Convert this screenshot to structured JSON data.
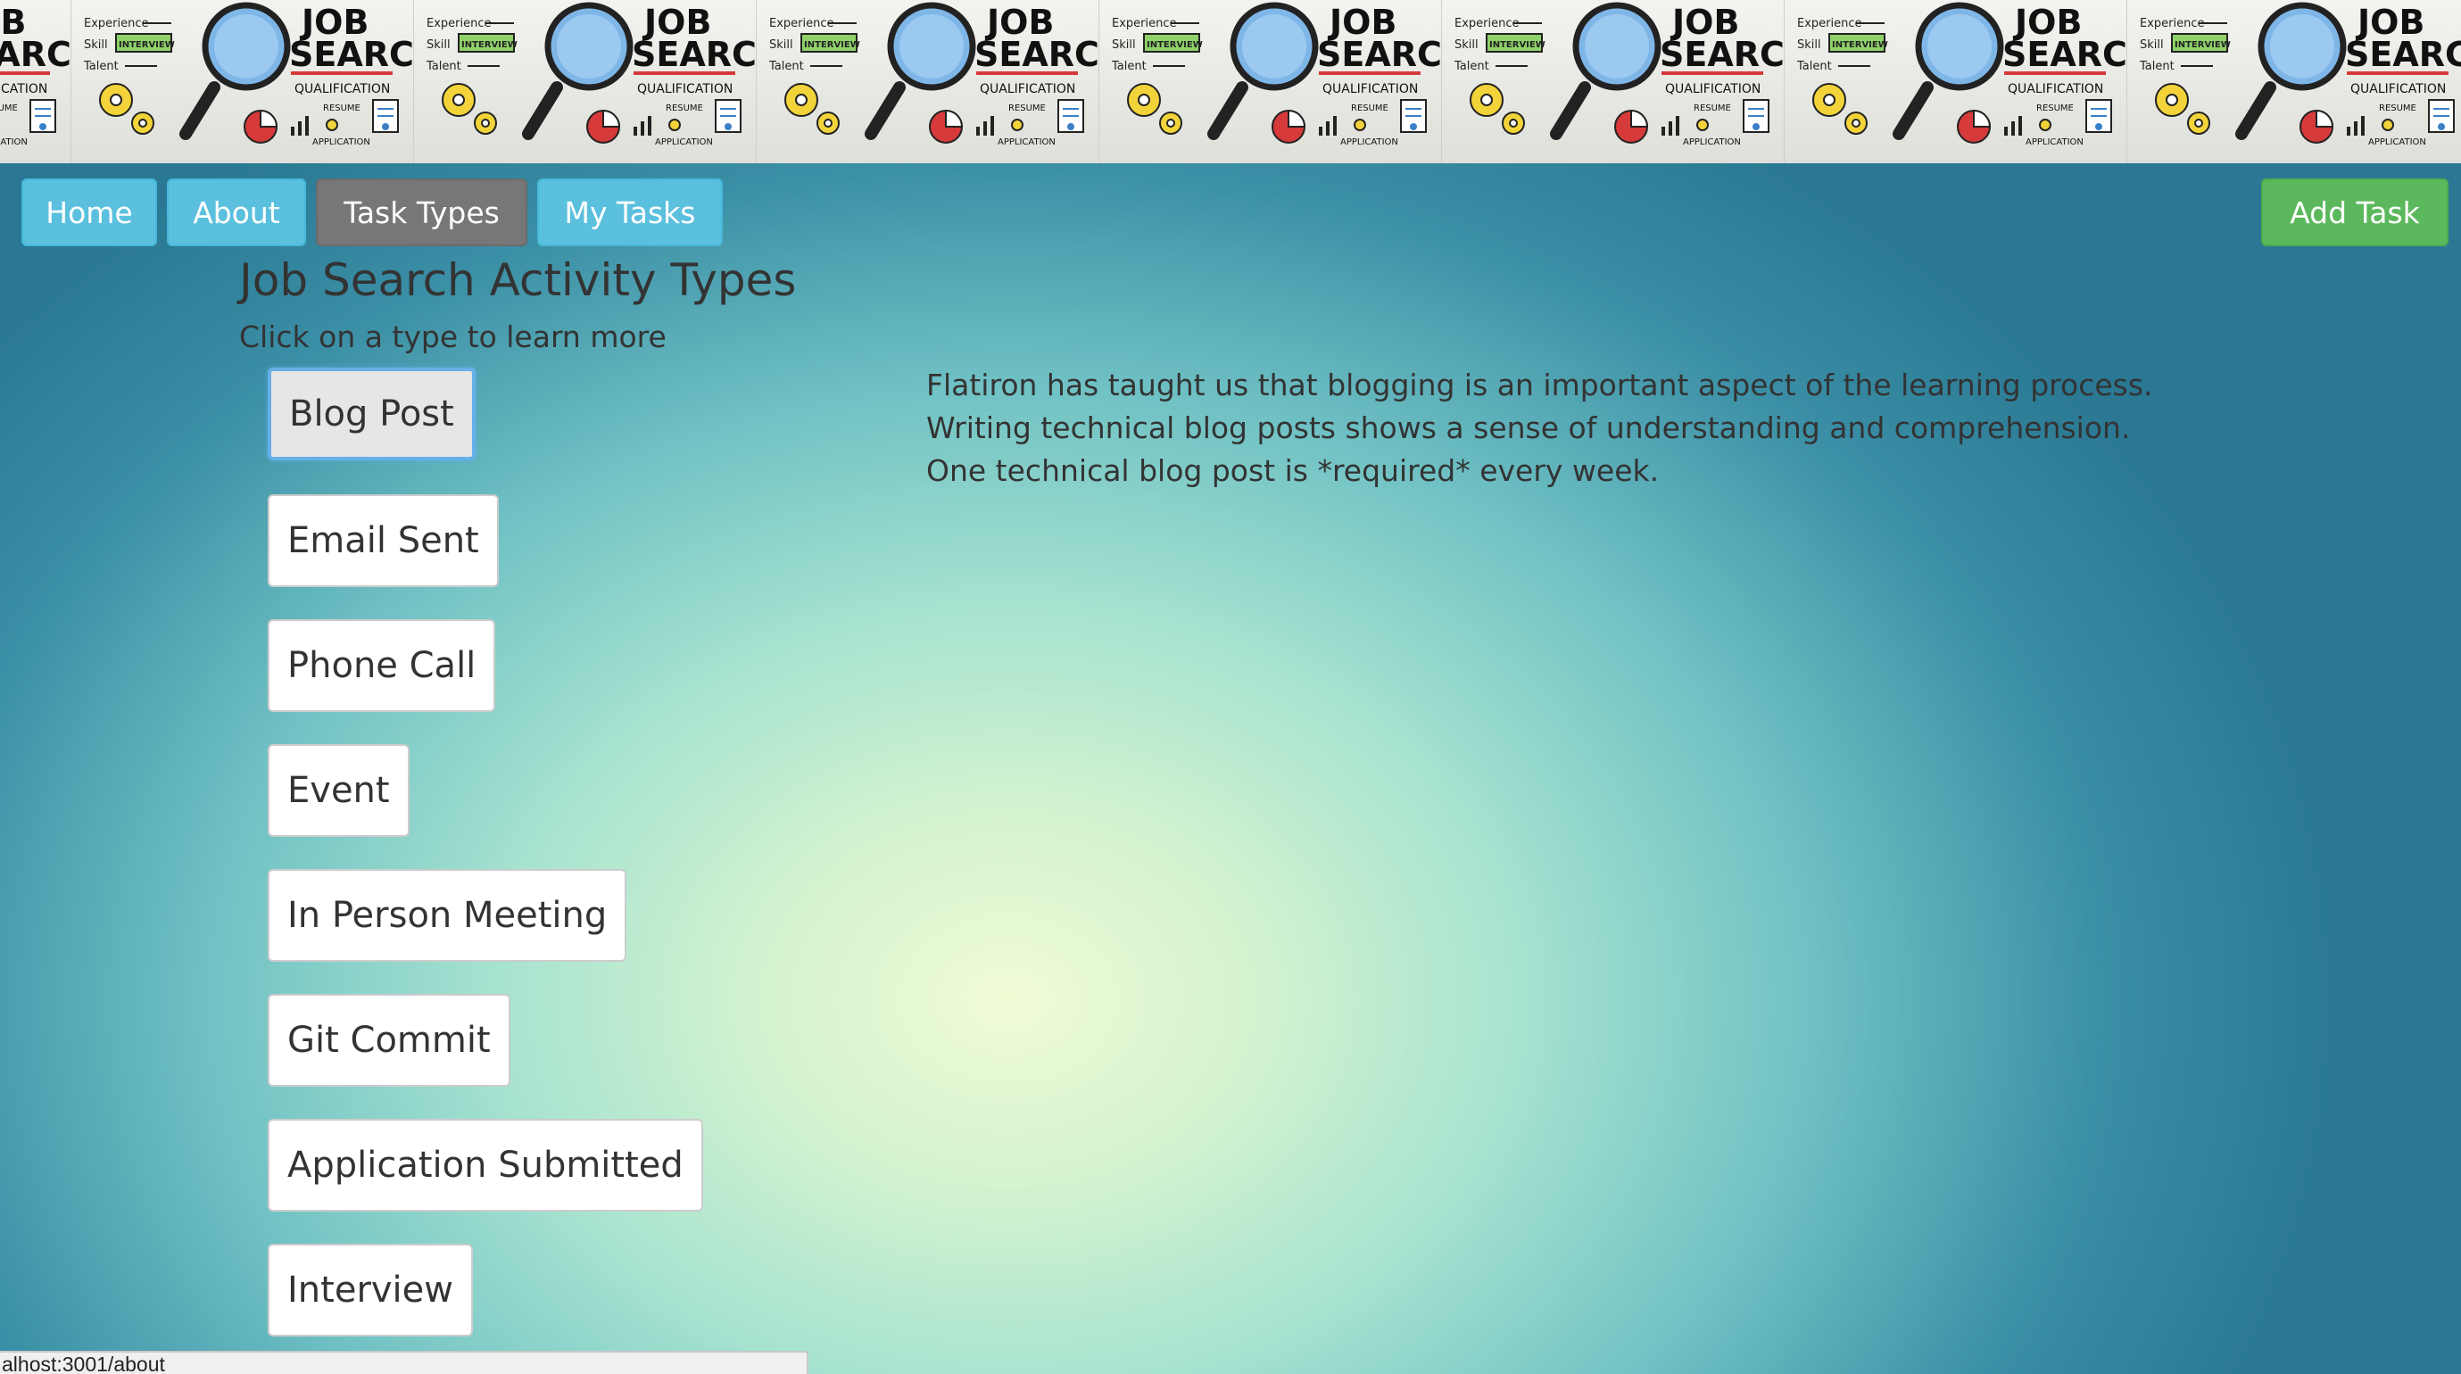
{
  "banner": {
    "title_line1": "JOB",
    "title_line2": "SEARCH",
    "qualification": "QUALIFICATION",
    "resume": "RESUME",
    "application": "APPLICATION",
    "interview": "INTERVIEW",
    "experience": "Experience",
    "skill": "Skill",
    "talent": "Talent"
  },
  "nav": {
    "home": "Home",
    "about": "About",
    "task_types": "Task Types",
    "my_tasks": "My Tasks",
    "add_task": "Add Task",
    "active": "Task Types"
  },
  "page": {
    "title": "Job Search Activity Types",
    "subtitle": "Click on a type to learn more"
  },
  "types": [
    "Blog Post",
    "Email Sent",
    "Phone Call",
    "Event",
    "In Person Meeting",
    "Git Commit",
    "Application Submitted",
    "Interview"
  ],
  "selected_type": "Blog Post",
  "description": "Flatiron has taught us that blogging is an important aspect of the learning process. Writing technical blog posts shows a sense of understanding and comprehension. One technical blog post is *required* every week.",
  "status_bar": {
    "url": "alhost:3001/about"
  },
  "colors": {
    "nav_info": "#5bc0de",
    "nav_active": "#777777",
    "add_task": "#5cb85c",
    "selected_border": "#66afe9"
  }
}
